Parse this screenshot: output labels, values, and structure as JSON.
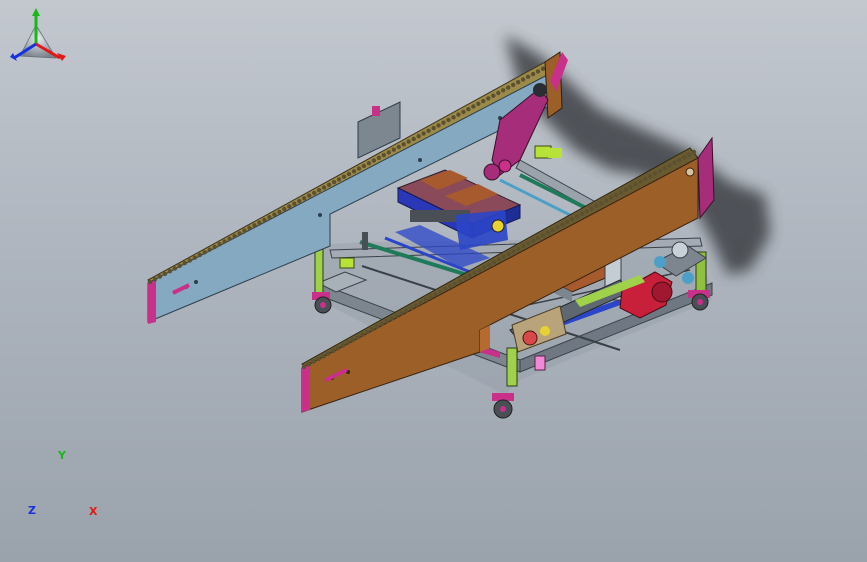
{
  "model": {
    "name": "",
    "colors": {
      "background_top": "#c3c8cf",
      "background_bottom": "#9aa2ac",
      "back_conveyor": "#7fa3ba",
      "front_conveyor": "#9c5f28",
      "frame_rail": "#8e969f",
      "chain": "#5b5130",
      "accent_magenta": "#c8308a",
      "accent_green": "#9fd24a",
      "accent_blue": "#2b45c8",
      "motor_red": "#c8203a",
      "shadow": "#3c3f44"
    }
  },
  "triad": {
    "x_label": "X",
    "y_label": "Y",
    "z_label": "Z",
    "x_color": "#e01818",
    "y_color": "#18b818",
    "z_color": "#1830e0"
  }
}
